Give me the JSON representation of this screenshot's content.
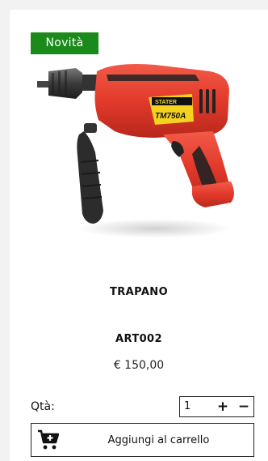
{
  "product": {
    "badge": "Novità",
    "image_label": "drill-image",
    "brand_on_image": "STATER",
    "model_on_image": "TM750A",
    "name": "TRAPANO",
    "code": "ART002",
    "price": "€ 150,00"
  },
  "quantity": {
    "label": "Qtà:",
    "value": "1",
    "plus": "+",
    "minus": "−"
  },
  "cart_button": {
    "label": "Aggiungi al carrello",
    "icon": "cart-add-icon"
  },
  "colors": {
    "badge_bg": "#1a8a1a",
    "drill_body": "#e23a2b",
    "page_bg": "#f2f2f2"
  }
}
